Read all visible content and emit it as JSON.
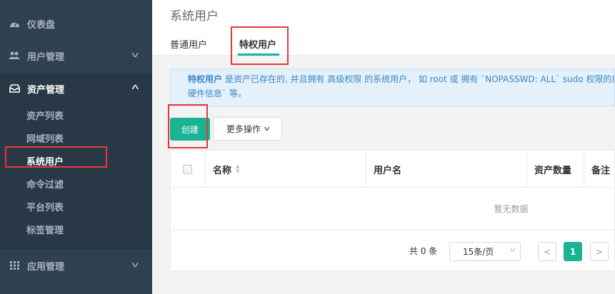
{
  "sidebar": {
    "items": [
      {
        "label": "仪表盘",
        "icon": "dashboard-icon"
      },
      {
        "label": "用户管理",
        "icon": "users-icon"
      },
      {
        "label": "资产管理",
        "icon": "inbox-icon"
      },
      {
        "label": "应用管理",
        "icon": "grid-icon"
      }
    ],
    "submenu": [
      "资产列表",
      "网域列表",
      "系统用户",
      "命令过滤",
      "平台列表",
      "标签管理"
    ]
  },
  "header": {
    "title": "系统用户",
    "tabs": [
      "普通用户",
      "特权用户"
    ]
  },
  "alert": {
    "strong": "特权用户",
    "line1": " 是资产已存在的, 并且拥有 高级权限 的系统用户， 如 root 或 拥有 `NOPASSWD: ALL` sudo 权限的用户。",
    "line2": "硬件信息` 等。"
  },
  "toolbar": {
    "create_label": "创建",
    "more_label": "更多操作"
  },
  "table": {
    "columns": [
      "名称",
      "用户名",
      "资产数量",
      "备注"
    ],
    "empty_text": "暂无数据"
  },
  "pagination": {
    "total": "共 0 条",
    "page_size": "15条/页",
    "prev": "<",
    "current": "1",
    "next": ">"
  },
  "colors": {
    "accent": "#1ab394",
    "sidebar": "#2f4050",
    "highlight": "#e53935"
  }
}
